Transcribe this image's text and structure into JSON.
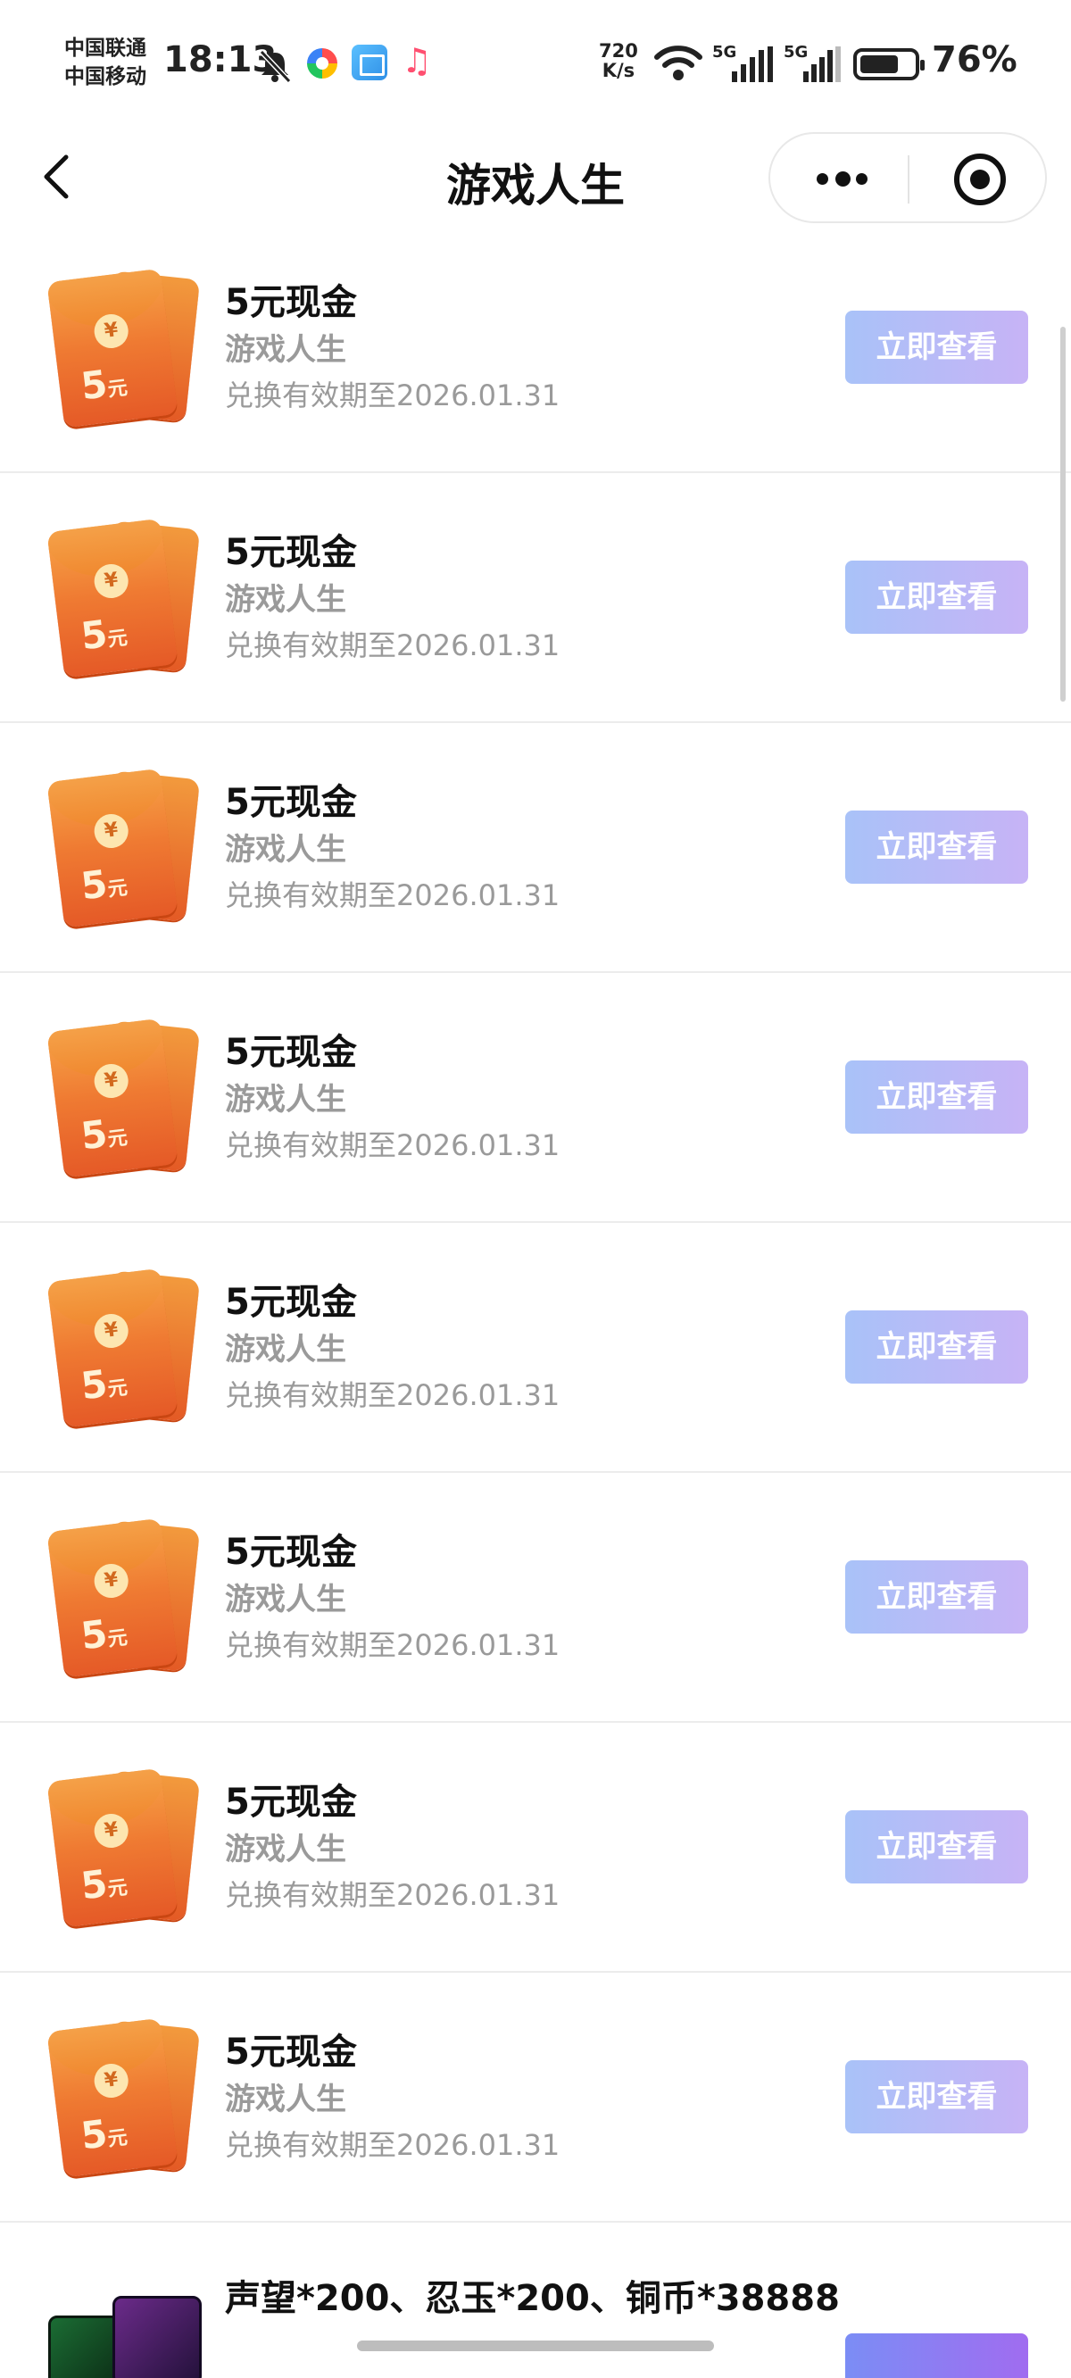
{
  "status_bar": {
    "carrier_1": "中国联通",
    "carrier_2": "中国移动",
    "time": "18:13",
    "net_speed_value": "720",
    "net_speed_unit": "K/s",
    "signal_1": "5G",
    "signal_2": "5G",
    "battery": "76%"
  },
  "header": {
    "title": "游戏人生",
    "back_icon": "chevron-left-icon",
    "more_icon": "more-dots-icon",
    "close_icon": "target-close-icon"
  },
  "items": [
    {
      "title": "5元现金",
      "subtitle": "游戏人生",
      "expiry": "兑换有效期至2026.01.31",
      "button": "立即查看",
      "coin": "¥",
      "amount": "5",
      "unit": "元"
    },
    {
      "title": "5元现金",
      "subtitle": "游戏人生",
      "expiry": "兑换有效期至2026.01.31",
      "button": "立即查看",
      "coin": "¥",
      "amount": "5",
      "unit": "元"
    },
    {
      "title": "5元现金",
      "subtitle": "游戏人生",
      "expiry": "兑换有效期至2026.01.31",
      "button": "立即查看",
      "coin": "¥",
      "amount": "5",
      "unit": "元"
    },
    {
      "title": "5元现金",
      "subtitle": "游戏人生",
      "expiry": "兑换有效期至2026.01.31",
      "button": "立即查看",
      "coin": "¥",
      "amount": "5",
      "unit": "元"
    },
    {
      "title": "5元现金",
      "subtitle": "游戏人生",
      "expiry": "兑换有效期至2026.01.31",
      "button": "立即查看",
      "coin": "¥",
      "amount": "5",
      "unit": "元"
    },
    {
      "title": "5元现金",
      "subtitle": "游戏人生",
      "expiry": "兑换有效期至2026.01.31",
      "button": "立即查看",
      "coin": "¥",
      "amount": "5",
      "unit": "元"
    },
    {
      "title": "5元现金",
      "subtitle": "游戏人生",
      "expiry": "兑换有效期至2026.01.31",
      "button": "立即查看",
      "coin": "¥",
      "amount": "5",
      "unit": "元"
    },
    {
      "title": "5元现金",
      "subtitle": "游戏人生",
      "expiry": "兑换有效期至2026.01.31",
      "button": "立即查看",
      "coin": "¥",
      "amount": "5",
      "unit": "元"
    }
  ],
  "partial_item": {
    "title": "声望*200、忍玉*200、铜币*38888"
  },
  "colors": {
    "button_gradient_start": "#a9c2f8",
    "button_gradient_end": "#c7b3f6",
    "envelope_orange": "#ef7a32",
    "subtitle_gray": "#9a9a9a"
  }
}
